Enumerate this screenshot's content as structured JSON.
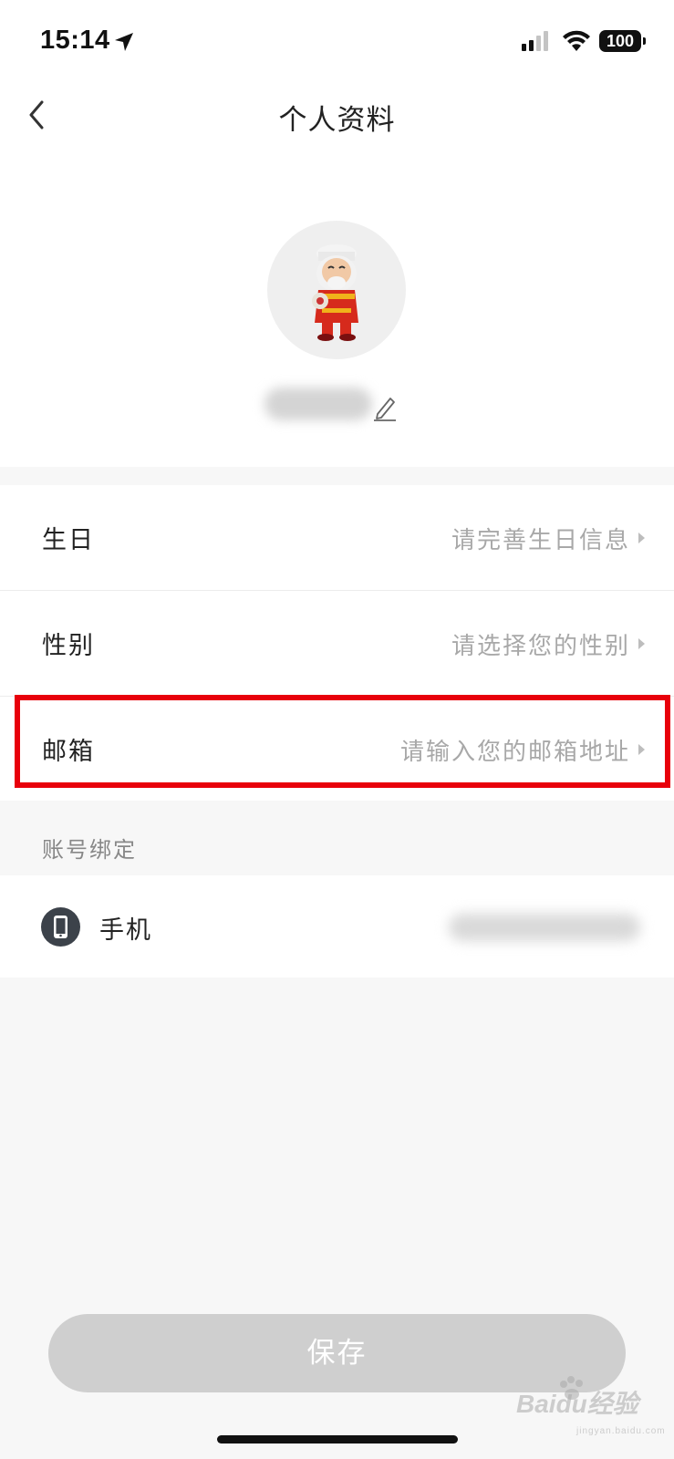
{
  "status_bar": {
    "time": "15:14",
    "battery": "100"
  },
  "nav": {
    "title": "个人资料",
    "back_icon": "chevron-left-icon"
  },
  "profile": {
    "avatar_description": "cartoon-character-avatar",
    "edit_icon": "pencil-icon"
  },
  "form": {
    "rows": [
      {
        "label": "生日",
        "value": "请完善生日信息"
      },
      {
        "label": "性别",
        "value": "请选择您的性别"
      },
      {
        "label": "邮箱",
        "value": "请输入您的邮箱地址"
      }
    ],
    "highlight_color": "#e8000b"
  },
  "binding": {
    "header": "账号绑定",
    "phone_label": "手机",
    "phone_icon": "phone-icon"
  },
  "save_button": {
    "label": "保存"
  },
  "watermark": {
    "text": "Baidu经验",
    "sub": "jingyan.baidu.com"
  }
}
